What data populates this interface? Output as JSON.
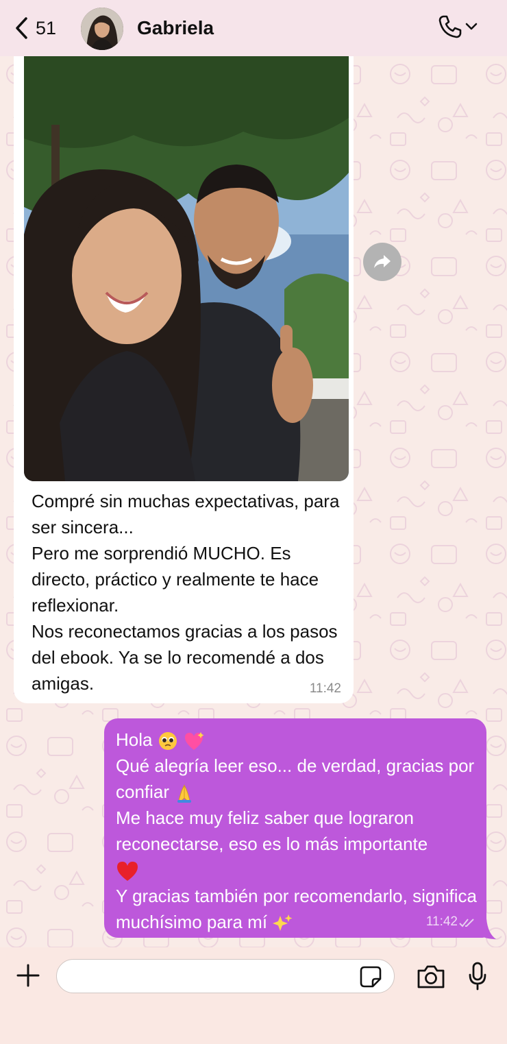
{
  "header": {
    "back_count": "51",
    "contact_name": "Gabriela"
  },
  "incoming_message": {
    "lines": [
      "Compré sin muchas expectativas, para ser sincera...",
      "Pero me sorprendió MUCHO. Es directo, práctico y realmente te hace reflexionar.",
      "Nos reconectamos gracias a los pasos del ebook. Ya se lo recomendé a dos amigas."
    ],
    "time": "11:42"
  },
  "outgoing_message": {
    "line1": "Hola",
    "line2": "Qué alegría leer eso... de verdad, gracias por confiar",
    "line3": "Me hace muy feliz saber que lograron reconectarse, eso es lo más importante",
    "line4": "Y gracias también por recomendarlo, significa muchísimo para mí",
    "time": "11:42"
  },
  "composer": {
    "input_value": ""
  },
  "colors": {
    "outgoing_bubble": "#bd58db",
    "incoming_bubble": "#ffffff",
    "chat_background": "#f9ebe7"
  },
  "icons": [
    "chevron-left-icon",
    "phone-icon",
    "chevron-down-icon",
    "forward-icon",
    "plus-icon",
    "sticker-icon",
    "camera-icon",
    "microphone-icon",
    "double-check-icon"
  ]
}
